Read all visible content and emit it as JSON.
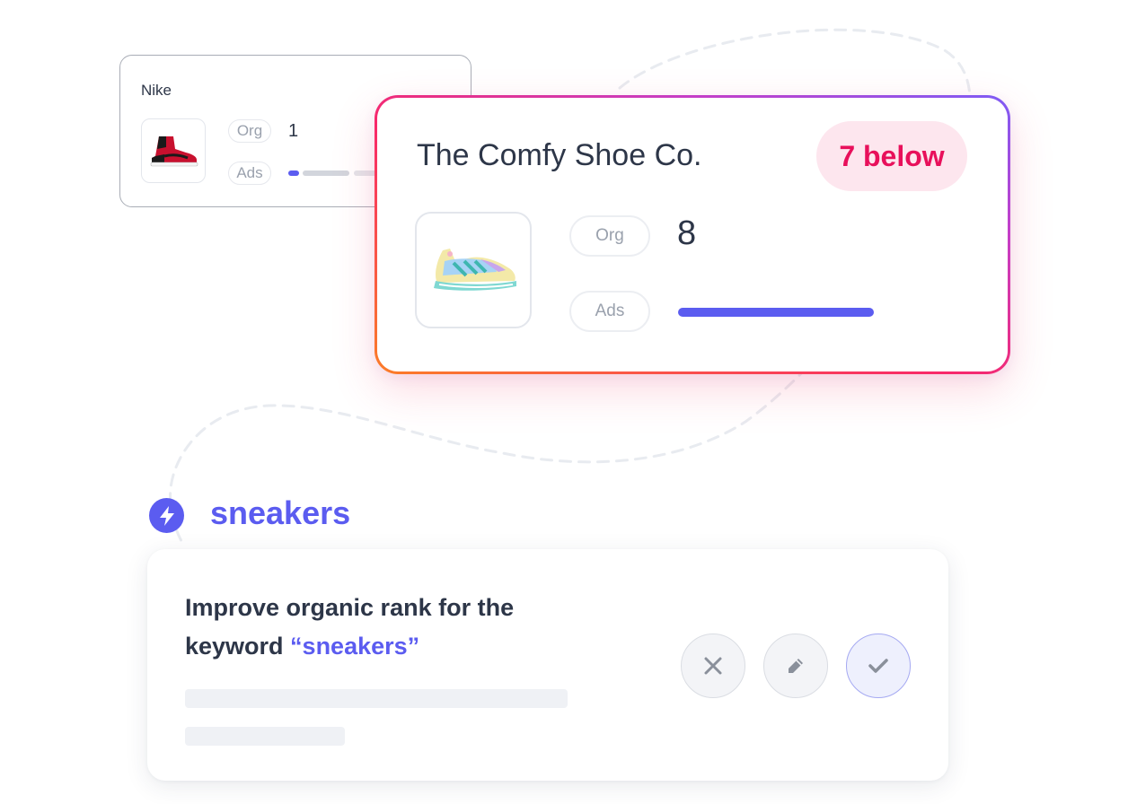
{
  "competitor_card": {
    "brand": "Nike",
    "organic_label": "Org",
    "ads_label": "Ads",
    "organic_rank": "1",
    "product_icon": "red-black-high-top-sneaker"
  },
  "own_card": {
    "brand": "The Comfy Shoe Co.",
    "comparison_badge": "7 below",
    "organic_label": "Org",
    "ads_label": "Ads",
    "organic_rank": "8",
    "product_icon": "pastel-running-shoe"
  },
  "keyword": {
    "icon": "lightning-bolt-icon",
    "text": "sneakers"
  },
  "suggestion": {
    "text_prefix": "Improve organic rank for the keyword ",
    "keyword_quoted": "“sneakers”",
    "actions": [
      "reject",
      "edit",
      "accept"
    ]
  },
  "colors": {
    "accent": "#5b5cf0",
    "badge_text": "#e8105b",
    "badge_bg": "#fde6ee",
    "gradient": [
      "#fb7d28",
      "#f8286a",
      "#c53ec8",
      "#7e5cf5"
    ]
  }
}
